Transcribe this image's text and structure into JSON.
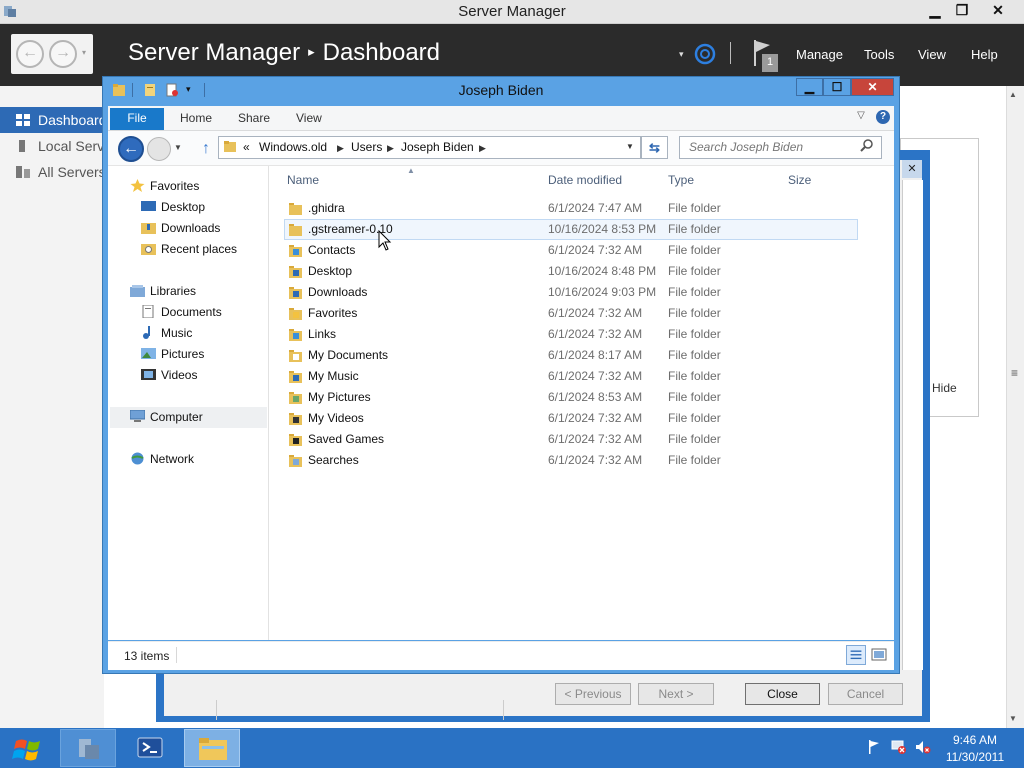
{
  "server_manager": {
    "title": "Server Manager",
    "breadcrumb_root": "Server Manager",
    "breadcrumb_page": "Dashboard",
    "notifications_count": "1",
    "menus": [
      "Manage",
      "Tools",
      "View",
      "Help"
    ],
    "nav_items": [
      "Dashboard",
      "Local Server",
      "All Servers"
    ],
    "panel_hide_label": "Hide"
  },
  "wizard": {
    "buttons": {
      "previous": "< Previous",
      "next": "Next >",
      "close": "Close",
      "cancel": "Cancel"
    }
  },
  "explorer": {
    "title": "Joseph Biden",
    "ribbon_tabs": [
      "File",
      "Home",
      "Share",
      "View"
    ],
    "address": {
      "overflow": "«",
      "segments": [
        "Windows.old",
        "Users",
        "Joseph Biden"
      ]
    },
    "search_placeholder": "Search Joseph Biden",
    "nav_pane": {
      "favorites": {
        "label": "Favorites",
        "items": [
          "Desktop",
          "Downloads",
          "Recent places"
        ]
      },
      "libraries": {
        "label": "Libraries",
        "items": [
          "Documents",
          "Music",
          "Pictures",
          "Videos"
        ]
      },
      "computer": "Computer",
      "network": "Network"
    },
    "columns": [
      "Name",
      "Date modified",
      "Type",
      "Size"
    ],
    "files": [
      {
        "name": ".ghidra",
        "date": "6/1/2024 7:47 AM",
        "type": "File folder",
        "icon": "folder-icon"
      },
      {
        "name": ".gstreamer-0.10",
        "date": "10/16/2024 8:53 PM",
        "type": "File folder",
        "icon": "folder-icon"
      },
      {
        "name": "Contacts",
        "date": "6/1/2024 7:32 AM",
        "type": "File folder",
        "icon": "contacts-folder-icon"
      },
      {
        "name": "Desktop",
        "date": "10/16/2024 8:48 PM",
        "type": "File folder",
        "icon": "desktop-folder-icon"
      },
      {
        "name": "Downloads",
        "date": "10/16/2024 9:03 PM",
        "type": "File folder",
        "icon": "downloads-folder-icon"
      },
      {
        "name": "Favorites",
        "date": "6/1/2024 7:32 AM",
        "type": "File folder",
        "icon": "favorites-folder-icon"
      },
      {
        "name": "Links",
        "date": "6/1/2024 7:32 AM",
        "type": "File folder",
        "icon": "links-folder-icon"
      },
      {
        "name": "My Documents",
        "date": "6/1/2024 8:17 AM",
        "type": "File folder",
        "icon": "documents-folder-icon"
      },
      {
        "name": "My Music",
        "date": "6/1/2024 7:32 AM",
        "type": "File folder",
        "icon": "music-folder-icon"
      },
      {
        "name": "My Pictures",
        "date": "6/1/2024 8:53 AM",
        "type": "File folder",
        "icon": "pictures-folder-icon"
      },
      {
        "name": "My Videos",
        "date": "6/1/2024 7:32 AM",
        "type": "File folder",
        "icon": "videos-folder-icon"
      },
      {
        "name": "Saved Games",
        "date": "6/1/2024 7:32 AM",
        "type": "File folder",
        "icon": "saved-games-folder-icon"
      },
      {
        "name": "Searches",
        "date": "6/1/2024 7:32 AM",
        "type": "File folder",
        "icon": "searches-folder-icon"
      }
    ],
    "status_count": "13 items"
  },
  "taskbar": {
    "time": "9:46 AM",
    "date": "11/30/2011"
  },
  "colors": {
    "accent_blue": "#2d6ab5",
    "window_frame": "#5aa2e4",
    "taskbar": "#2a72c4",
    "header_dark": "#2b2b2b",
    "folder_yellow": "#e8c15a"
  }
}
